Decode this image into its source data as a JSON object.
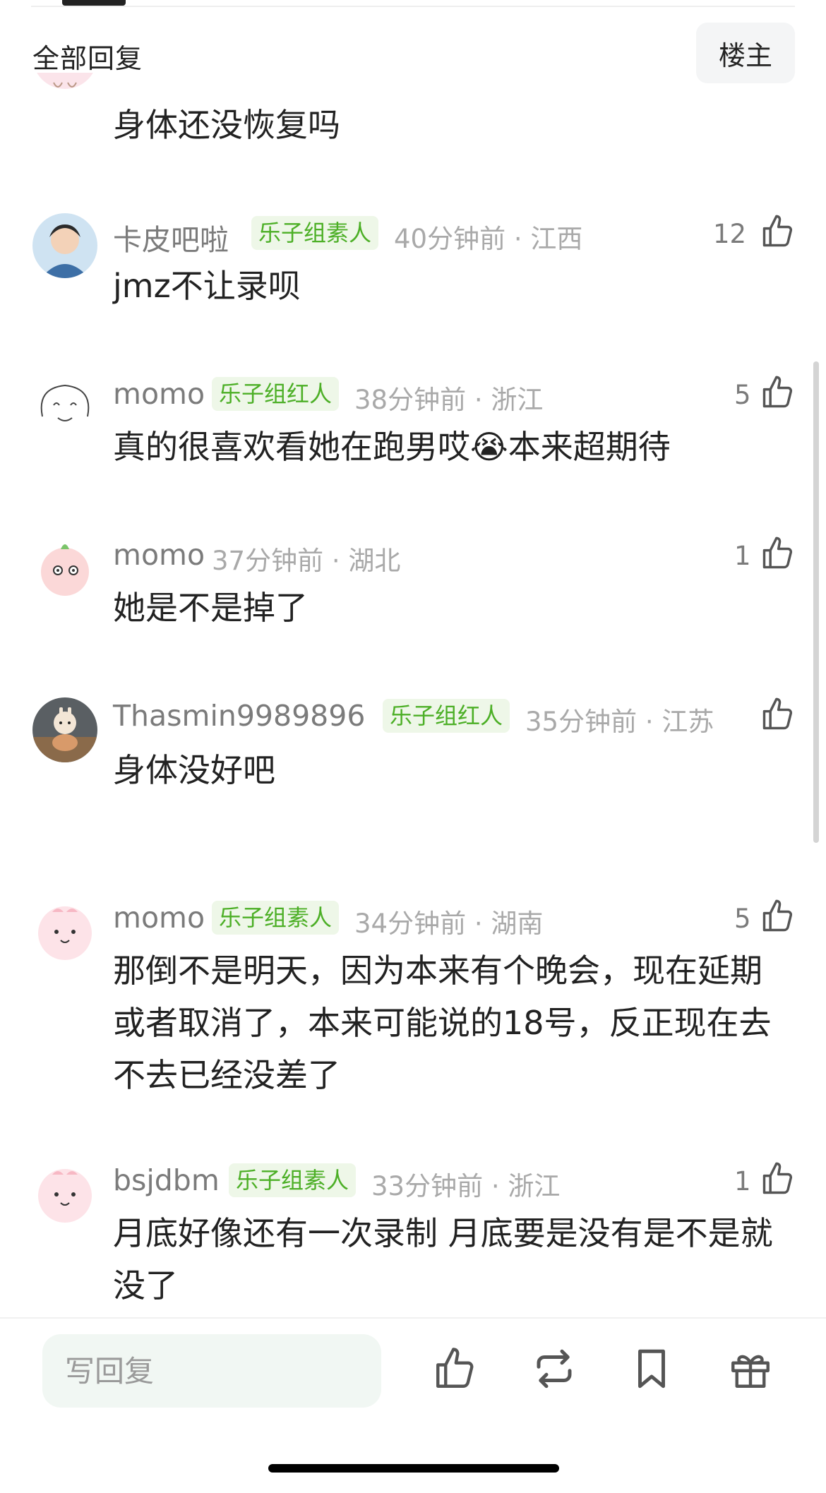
{
  "header": {
    "title": "全部回复",
    "op_label": "楼主"
  },
  "partial_comment": {
    "text": "身体还没恢复吗"
  },
  "comments": [
    {
      "username": "卡皮吧啦",
      "badge": "乐子组素人",
      "meta": "40分钟前 · 江西",
      "likes": "12",
      "text": "jmz不让录呗"
    },
    {
      "username": "momo",
      "badge": "乐子组红人",
      "meta": "38分钟前 · 浙江",
      "likes": "5",
      "text": "真的很喜欢看她在跑男哎😭本来超期待"
    },
    {
      "username": "momo",
      "badge": "",
      "meta": "37分钟前 · 湖北",
      "likes": "1",
      "text": "她是不是掉了"
    },
    {
      "username": "Thasmin9989896",
      "badge": "乐子组红人",
      "meta": "35分钟前 · 江苏",
      "likes": "",
      "text": "身体没好吧"
    },
    {
      "username": "momo",
      "badge": "乐子组素人",
      "meta": "34分钟前 · 湖南",
      "likes": "5",
      "text": "那倒不是明天，因为本来有个晚会，现在延期或者取消了，本来可能说的18号，反正现在去不去已经没差了"
    },
    {
      "username": "bsjdbm",
      "badge": "乐子组素人",
      "meta": "33分钟前 · 浙江",
      "likes": "1",
      "text": "月底好像还有一次录制 月底要是没有是不是就没了"
    }
  ],
  "bottom_bar": {
    "reply_placeholder": "写回复",
    "actions": [
      "thumbs-up-icon",
      "repost-icon",
      "bookmark-icon",
      "gift-icon"
    ]
  },
  "colors": {
    "badge_bg": "#eef7e8",
    "badge_text": "#4caf26",
    "meta": "#a9a9a9",
    "username": "#7b7b7b"
  }
}
